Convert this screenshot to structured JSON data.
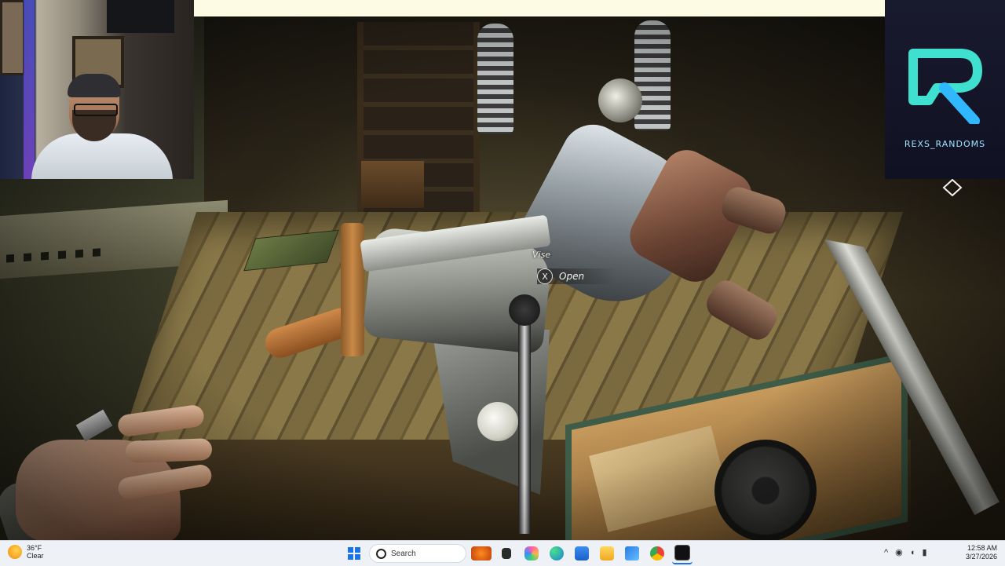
{
  "game": {
    "interaction_target": "Vise",
    "action_key": "X",
    "action_label": "Open"
  },
  "stream_overlay": {
    "channel_name": "REXS_RANDOMS",
    "logo_letter": "R",
    "logo_color": "#3fe0d0"
  },
  "taskbar": {
    "weather": {
      "temp": "36°F",
      "condition": "Clear"
    },
    "search_placeholder": "Search",
    "apps": [
      "halloween-widget-icon",
      "terminal-icon",
      "copilot-icon",
      "edge-icon",
      "store-icon",
      "file-explorer-icon",
      "mail-icon",
      "chrome-icon",
      "game-app-icon"
    ],
    "tray": {
      "chevron": "^",
      "wifi_icon": "wifi-icon",
      "volume_icon": "volume-icon",
      "battery_icon": "battery-icon"
    },
    "time": "12:58 AM",
    "date": "3/27/2026"
  }
}
